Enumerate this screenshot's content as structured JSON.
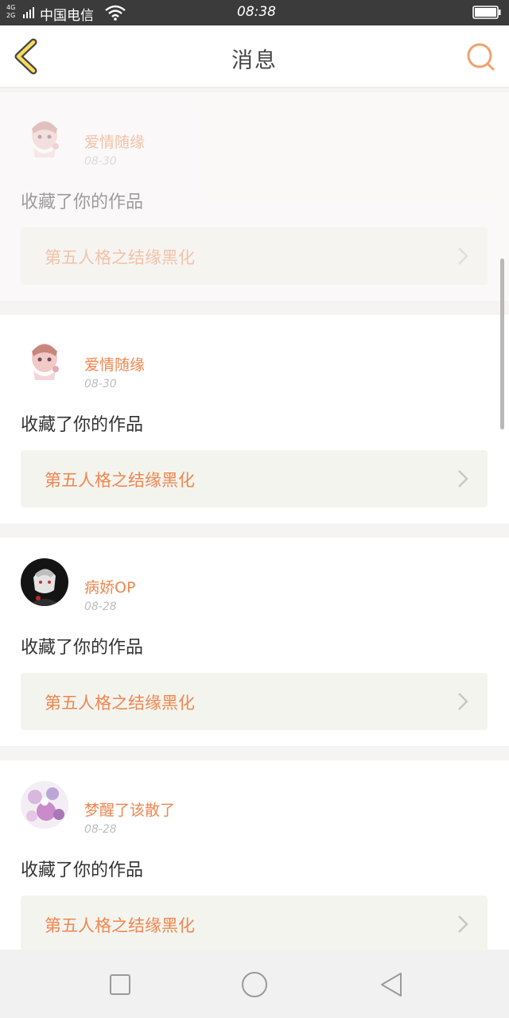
{
  "status_bar": {
    "network": "4G\n2G",
    "carrier": "中国电信",
    "time": "08:38",
    "icons": [
      "signal-icon",
      "wifi-icon",
      "battery-icon"
    ]
  },
  "header": {
    "title": "消息",
    "back_icon": "chevron-left-icon",
    "search_icon": "search-icon",
    "accent_color": "#f0864f"
  },
  "messages": [
    {
      "username": "爱情随缘",
      "date": "08-30",
      "action": "收藏了你的作品",
      "work_title": "第五人格之结缘黑化",
      "avatar": "anime-girl-avatar",
      "faded": true
    },
    {
      "username": "爱情随缘",
      "date": "08-30",
      "action": "收藏了你的作品",
      "work_title": "第五人格之结缘黑化",
      "avatar": "anime-girl-avatar",
      "faded": false
    },
    {
      "username": "病娇OP",
      "date": "08-28",
      "action": "收藏了你的作品",
      "work_title": "第五人格之结缘黑化",
      "avatar": "dark-character-avatar",
      "faded": false
    },
    {
      "username": "梦醒了该散了",
      "date": "08-28",
      "action": "收藏了你的作品",
      "work_title": "第五人格之结缘黑化",
      "avatar": "floral-avatar",
      "faded": false
    }
  ],
  "nav": [
    "recents-square-icon",
    "home-circle-icon",
    "back-triangle-icon"
  ]
}
